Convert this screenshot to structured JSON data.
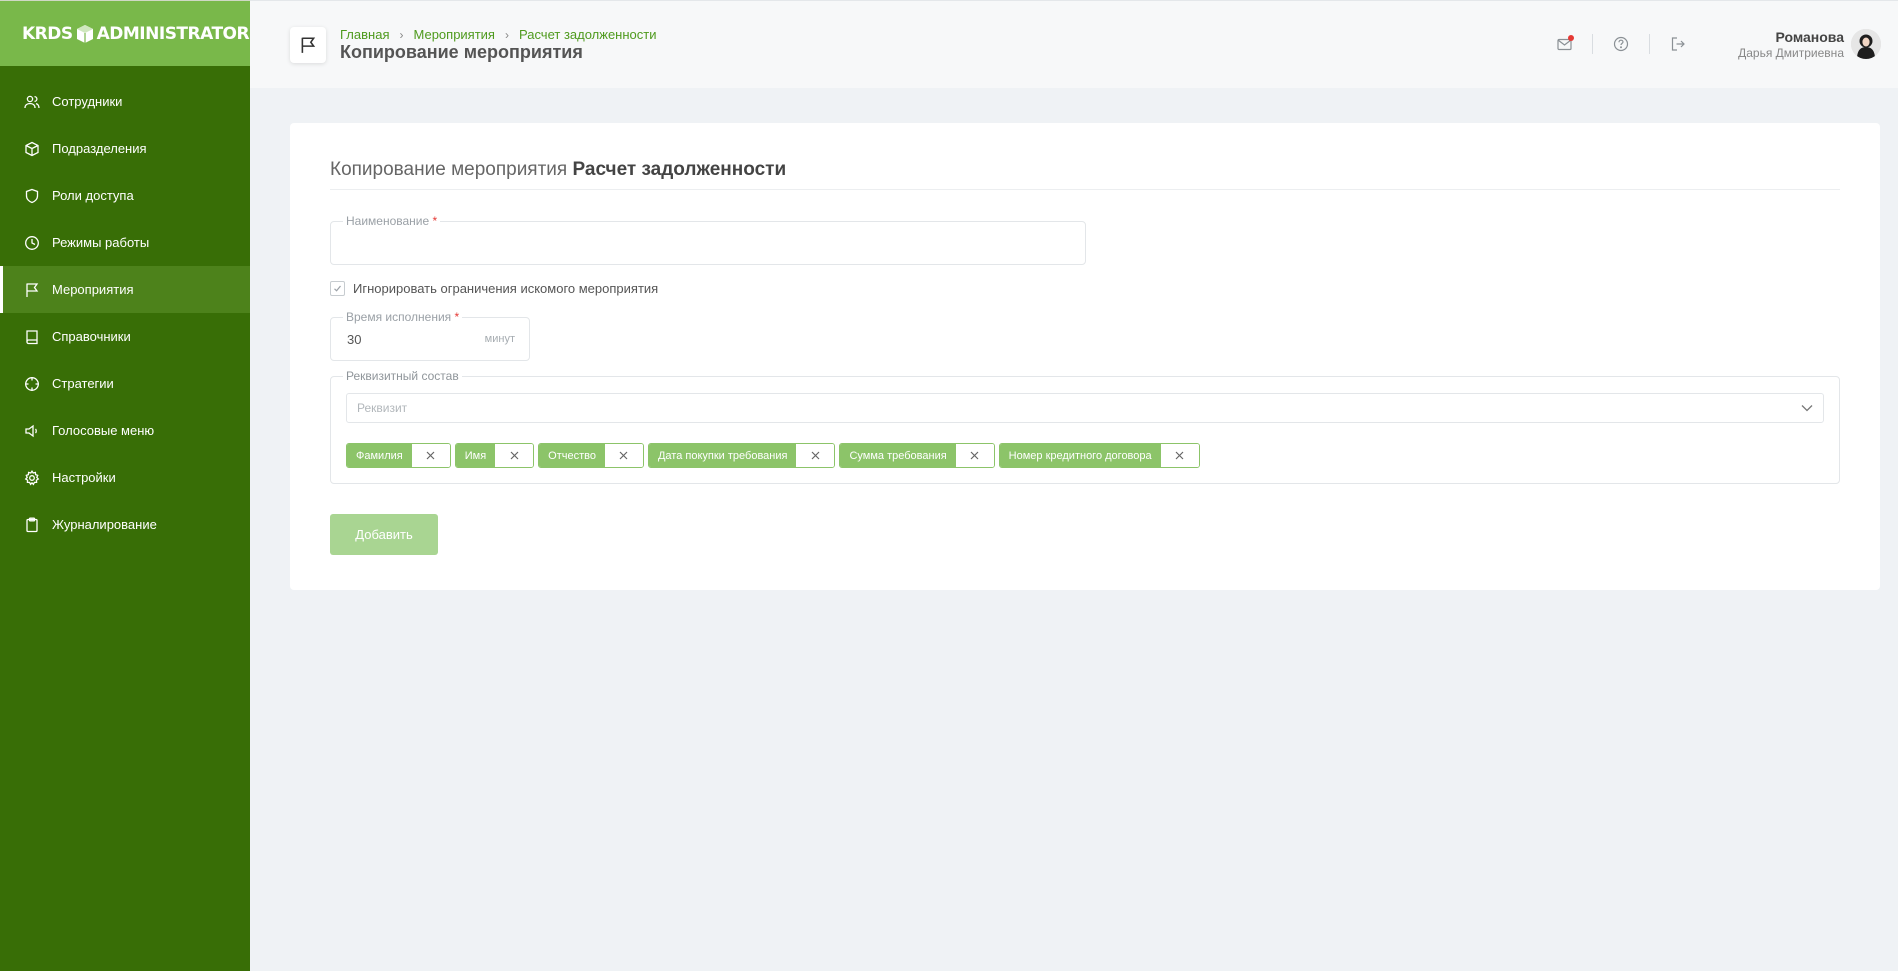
{
  "brand": {
    "left": "KRDS",
    "right": "ADMINISTRATOR"
  },
  "sidebar": {
    "items": [
      {
        "label": "Сотрудники",
        "icon": "users-icon"
      },
      {
        "label": "Подразделения",
        "icon": "box-icon"
      },
      {
        "label": "Роли доступа",
        "icon": "shield-icon"
      },
      {
        "label": "Режимы работы",
        "icon": "clock-icon"
      },
      {
        "label": "Мероприятия",
        "icon": "flag-icon",
        "active": true
      },
      {
        "label": "Справочники",
        "icon": "book-icon"
      },
      {
        "label": "Стратегии",
        "icon": "crosshair-icon"
      },
      {
        "label": "Голосовые меню",
        "icon": "speaker-icon"
      },
      {
        "label": "Настройки",
        "icon": "gear-icon"
      },
      {
        "label": "Журналирование",
        "icon": "clipboard-icon"
      }
    ]
  },
  "header": {
    "breadcrumb": [
      "Главная",
      "Мероприятия",
      "Расчет задолженности"
    ],
    "title": "Копирование мероприятия",
    "user": {
      "last_name": "Романова",
      "first_name": "Дарья Дмитриевна"
    }
  },
  "form": {
    "title_prefix": "Копирование мероприятия",
    "title_name": "Расчет задолженности",
    "name_field": {
      "label": "Наименование",
      "required_mark": "*",
      "value": ""
    },
    "ignore_checkbox": {
      "label": "Игнорировать ограничения искомого мероприятия",
      "checked": true
    },
    "duration": {
      "label": "Время исполнения",
      "required_mark": "*",
      "value": "30",
      "unit": "минут"
    },
    "requisites": {
      "label": "Реквизитный состав",
      "placeholder": "Реквизит",
      "tags": [
        "Фамилия",
        "Имя",
        "Отчество",
        "Дата покупки требования",
        "Сумма требования",
        "Номер кредитного договора"
      ]
    },
    "submit_label": "Добавить"
  },
  "colors": {
    "sidebar": "#386e06",
    "sidebar_head": "#79b84a",
    "accent": "#4e9a1d",
    "tag": "#8cc469",
    "button": "#a9d592"
  }
}
